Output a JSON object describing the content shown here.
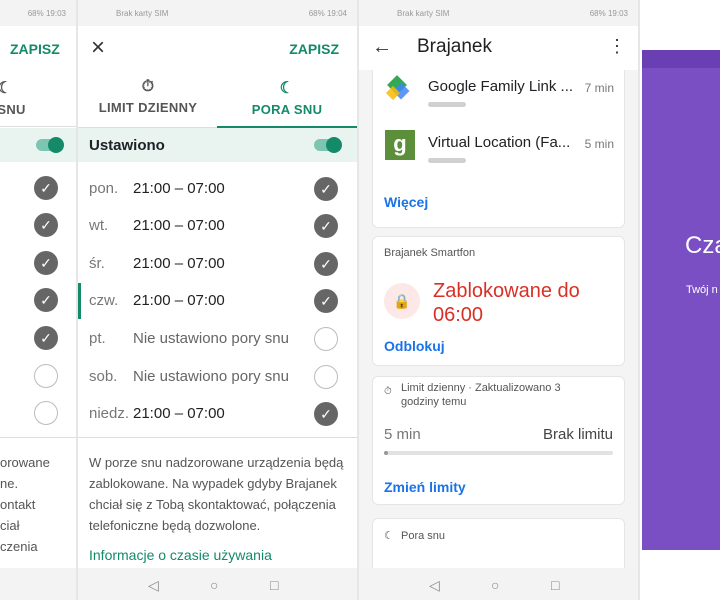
{
  "status": {
    "left": "Brak karty SIM",
    "right_p1": "68% 19:03",
    "right_p2": "68% 19:04",
    "right_p3": "68% 19:03"
  },
  "panel1": {
    "save": "ZAPISZ",
    "tab_bedtime": "A SNU",
    "texts": [
      "orowane",
      "ne.",
      "ontakt",
      "ciał",
      "czenia"
    ]
  },
  "panel2": {
    "close_icon": "×",
    "save": "ZAPISZ",
    "tab_daily_limit": "LIMIT DZIENNY",
    "tab_bedtime": "PORA SNU",
    "set_label": "Ustawiono",
    "days": [
      {
        "day": "pon.",
        "time": "21:00 – 07:00",
        "set": true
      },
      {
        "day": "wt.",
        "time": "21:00 – 07:00",
        "set": true
      },
      {
        "day": "śr.",
        "time": "21:00 – 07:00",
        "set": true
      },
      {
        "day": "czw.",
        "time": "21:00 – 07:00",
        "set": true
      },
      {
        "day": "pt.",
        "time": "Nie ustawiono pory snu",
        "set": false
      },
      {
        "day": "sob.",
        "time": "Nie ustawiono pory snu",
        "set": false
      },
      {
        "day": "niedz.",
        "time": "21:00 – 07:00",
        "set": true
      }
    ],
    "info": "W porze snu nadzorowane urządzenia będą zablokowane. Na wypadek gdyby Brajanek chciał się z Tobą skontaktować, połączenia telefoniczne będą dozwolone.",
    "info_link": "Informacje o czasie używania"
  },
  "panel3": {
    "title": "Brajanek",
    "apps": [
      {
        "name": "Google Family Link ...",
        "time": "7 min"
      },
      {
        "name": "Virtual Location (Fa...",
        "time": "5 min"
      }
    ],
    "more": "Więcej",
    "device": "Brajanek Smartfon",
    "locked": "Zablokowane do 06:00",
    "unlock": "Odblokuj",
    "limit_header": "Limit dzienny · Zaktualizowano 3 godziny temu",
    "limit_used": "5 min",
    "limit_value": "Brak limitu",
    "change_limits": "Zmień limity",
    "bedtime": "Pora snu"
  },
  "panel4": {
    "title": "Cza",
    "subtitle": "Twój n"
  },
  "colors": {
    "accent": "#148a68",
    "blue": "#1a73e8",
    "red": "#d93025",
    "purple": "#7b4fc4"
  }
}
